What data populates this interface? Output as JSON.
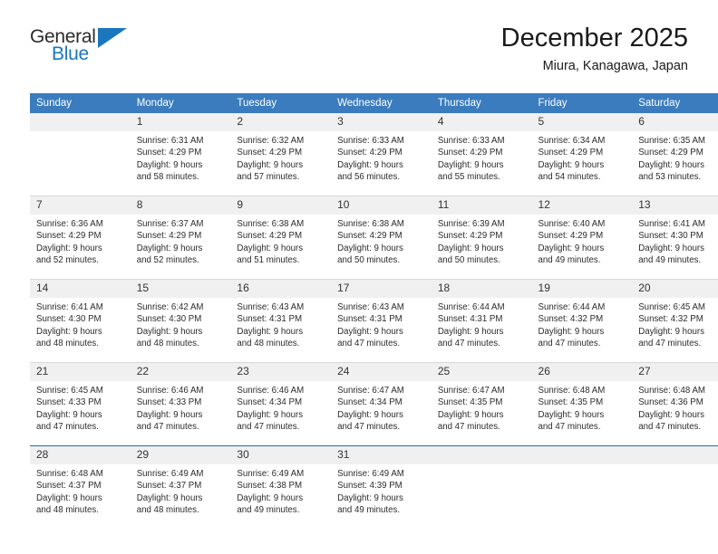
{
  "brand": {
    "name_part1": "General",
    "name_part2": "Blue",
    "accent_color": "#1b76bc"
  },
  "header": {
    "title": "December 2025",
    "subtitle": "Miura, Kanagawa, Japan"
  },
  "colors": {
    "header_row_bg": "#3a7cbe",
    "daynum_bg": "#f0f0f0",
    "text": "#2c2c2c"
  },
  "weekdays": [
    "Sunday",
    "Monday",
    "Tuesday",
    "Wednesday",
    "Thursday",
    "Friday",
    "Saturday"
  ],
  "weeks": [
    [
      {
        "day": "",
        "blank": true,
        "sunrise": "",
        "sunset": "",
        "daylight1": "",
        "daylight2": ""
      },
      {
        "day": "1",
        "sunrise": "Sunrise: 6:31 AM",
        "sunset": "Sunset: 4:29 PM",
        "daylight1": "Daylight: 9 hours",
        "daylight2": "and 58 minutes."
      },
      {
        "day": "2",
        "sunrise": "Sunrise: 6:32 AM",
        "sunset": "Sunset: 4:29 PM",
        "daylight1": "Daylight: 9 hours",
        "daylight2": "and 57 minutes."
      },
      {
        "day": "3",
        "sunrise": "Sunrise: 6:33 AM",
        "sunset": "Sunset: 4:29 PM",
        "daylight1": "Daylight: 9 hours",
        "daylight2": "and 56 minutes."
      },
      {
        "day": "4",
        "sunrise": "Sunrise: 6:33 AM",
        "sunset": "Sunset: 4:29 PM",
        "daylight1": "Daylight: 9 hours",
        "daylight2": "and 55 minutes."
      },
      {
        "day": "5",
        "sunrise": "Sunrise: 6:34 AM",
        "sunset": "Sunset: 4:29 PM",
        "daylight1": "Daylight: 9 hours",
        "daylight2": "and 54 minutes."
      },
      {
        "day": "6",
        "sunrise": "Sunrise: 6:35 AM",
        "sunset": "Sunset: 4:29 PM",
        "daylight1": "Daylight: 9 hours",
        "daylight2": "and 53 minutes."
      }
    ],
    [
      {
        "day": "7",
        "sunrise": "Sunrise: 6:36 AM",
        "sunset": "Sunset: 4:29 PM",
        "daylight1": "Daylight: 9 hours",
        "daylight2": "and 52 minutes."
      },
      {
        "day": "8",
        "sunrise": "Sunrise: 6:37 AM",
        "sunset": "Sunset: 4:29 PM",
        "daylight1": "Daylight: 9 hours",
        "daylight2": "and 52 minutes."
      },
      {
        "day": "9",
        "sunrise": "Sunrise: 6:38 AM",
        "sunset": "Sunset: 4:29 PM",
        "daylight1": "Daylight: 9 hours",
        "daylight2": "and 51 minutes."
      },
      {
        "day": "10",
        "sunrise": "Sunrise: 6:38 AM",
        "sunset": "Sunset: 4:29 PM",
        "daylight1": "Daylight: 9 hours",
        "daylight2": "and 50 minutes."
      },
      {
        "day": "11",
        "sunrise": "Sunrise: 6:39 AM",
        "sunset": "Sunset: 4:29 PM",
        "daylight1": "Daylight: 9 hours",
        "daylight2": "and 50 minutes."
      },
      {
        "day": "12",
        "sunrise": "Sunrise: 6:40 AM",
        "sunset": "Sunset: 4:29 PM",
        "daylight1": "Daylight: 9 hours",
        "daylight2": "and 49 minutes."
      },
      {
        "day": "13",
        "sunrise": "Sunrise: 6:41 AM",
        "sunset": "Sunset: 4:30 PM",
        "daylight1": "Daylight: 9 hours",
        "daylight2": "and 49 minutes."
      }
    ],
    [
      {
        "day": "14",
        "sunrise": "Sunrise: 6:41 AM",
        "sunset": "Sunset: 4:30 PM",
        "daylight1": "Daylight: 9 hours",
        "daylight2": "and 48 minutes."
      },
      {
        "day": "15",
        "sunrise": "Sunrise: 6:42 AM",
        "sunset": "Sunset: 4:30 PM",
        "daylight1": "Daylight: 9 hours",
        "daylight2": "and 48 minutes."
      },
      {
        "day": "16",
        "sunrise": "Sunrise: 6:43 AM",
        "sunset": "Sunset: 4:31 PM",
        "daylight1": "Daylight: 9 hours",
        "daylight2": "and 48 minutes."
      },
      {
        "day": "17",
        "sunrise": "Sunrise: 6:43 AM",
        "sunset": "Sunset: 4:31 PM",
        "daylight1": "Daylight: 9 hours",
        "daylight2": "and 47 minutes."
      },
      {
        "day": "18",
        "sunrise": "Sunrise: 6:44 AM",
        "sunset": "Sunset: 4:31 PM",
        "daylight1": "Daylight: 9 hours",
        "daylight2": "and 47 minutes."
      },
      {
        "day": "19",
        "sunrise": "Sunrise: 6:44 AM",
        "sunset": "Sunset: 4:32 PM",
        "daylight1": "Daylight: 9 hours",
        "daylight2": "and 47 minutes."
      },
      {
        "day": "20",
        "sunrise": "Sunrise: 6:45 AM",
        "sunset": "Sunset: 4:32 PM",
        "daylight1": "Daylight: 9 hours",
        "daylight2": "and 47 minutes."
      }
    ],
    [
      {
        "day": "21",
        "sunrise": "Sunrise: 6:45 AM",
        "sunset": "Sunset: 4:33 PM",
        "daylight1": "Daylight: 9 hours",
        "daylight2": "and 47 minutes."
      },
      {
        "day": "22",
        "sunrise": "Sunrise: 6:46 AM",
        "sunset": "Sunset: 4:33 PM",
        "daylight1": "Daylight: 9 hours",
        "daylight2": "and 47 minutes."
      },
      {
        "day": "23",
        "sunrise": "Sunrise: 6:46 AM",
        "sunset": "Sunset: 4:34 PM",
        "daylight1": "Daylight: 9 hours",
        "daylight2": "and 47 minutes."
      },
      {
        "day": "24",
        "sunrise": "Sunrise: 6:47 AM",
        "sunset": "Sunset: 4:34 PM",
        "daylight1": "Daylight: 9 hours",
        "daylight2": "and 47 minutes."
      },
      {
        "day": "25",
        "sunrise": "Sunrise: 6:47 AM",
        "sunset": "Sunset: 4:35 PM",
        "daylight1": "Daylight: 9 hours",
        "daylight2": "and 47 minutes."
      },
      {
        "day": "26",
        "sunrise": "Sunrise: 6:48 AM",
        "sunset": "Sunset: 4:35 PM",
        "daylight1": "Daylight: 9 hours",
        "daylight2": "and 47 minutes."
      },
      {
        "day": "27",
        "sunrise": "Sunrise: 6:48 AM",
        "sunset": "Sunset: 4:36 PM",
        "daylight1": "Daylight: 9 hours",
        "daylight2": "and 47 minutes."
      }
    ],
    [
      {
        "day": "28",
        "sunrise": "Sunrise: 6:48 AM",
        "sunset": "Sunset: 4:37 PM",
        "daylight1": "Daylight: 9 hours",
        "daylight2": "and 48 minutes."
      },
      {
        "day": "29",
        "sunrise": "Sunrise: 6:49 AM",
        "sunset": "Sunset: 4:37 PM",
        "daylight1": "Daylight: 9 hours",
        "daylight2": "and 48 minutes."
      },
      {
        "day": "30",
        "sunrise": "Sunrise: 6:49 AM",
        "sunset": "Sunset: 4:38 PM",
        "daylight1": "Daylight: 9 hours",
        "daylight2": "and 49 minutes."
      },
      {
        "day": "31",
        "sunrise": "Sunrise: 6:49 AM",
        "sunset": "Sunset: 4:39 PM",
        "daylight1": "Daylight: 9 hours",
        "daylight2": "and 49 minutes."
      },
      {
        "day": "",
        "blank": true,
        "sunrise": "",
        "sunset": "",
        "daylight1": "",
        "daylight2": ""
      },
      {
        "day": "",
        "blank": true,
        "sunrise": "",
        "sunset": "",
        "daylight1": "",
        "daylight2": ""
      },
      {
        "day": "",
        "blank": true,
        "sunrise": "",
        "sunset": "",
        "daylight1": "",
        "daylight2": ""
      }
    ]
  ]
}
